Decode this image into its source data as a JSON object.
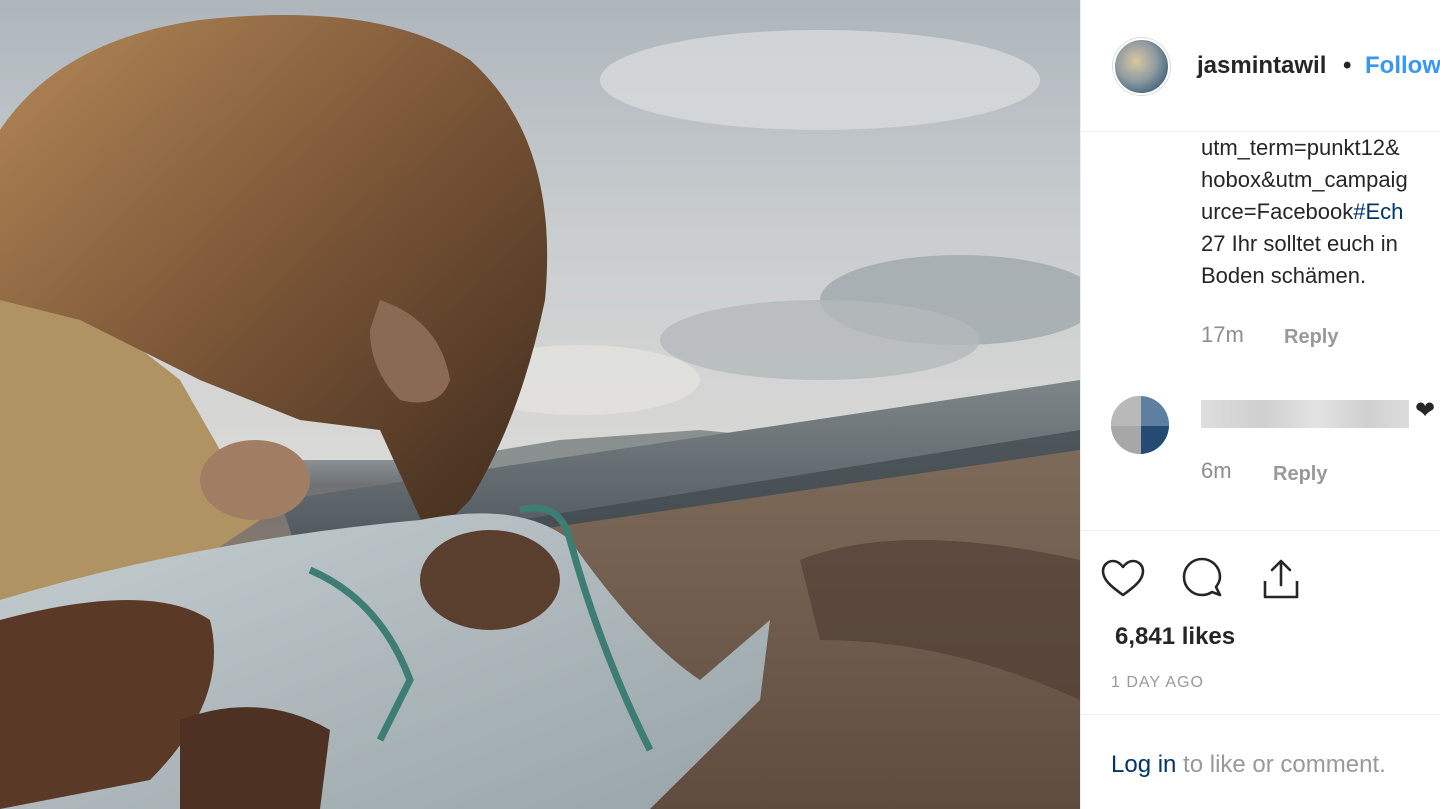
{
  "post": {
    "username": "jasmintawil",
    "separator": "•",
    "follow_label": "Follow",
    "likes": "6,841 likes",
    "date": "1 DAY AGO"
  },
  "comments": [
    {
      "lines": [
        "utm_term=punkt12&",
        "hobox&utm_campaig",
        "urce=Facebook",
        "27 Ihr solltet euch in",
        "Boden schämen."
      ],
      "hashtag": "#Ech",
      "time": "17m",
      "reply_label": "Reply"
    },
    {
      "time": "6m",
      "reply_label": "Reply"
    }
  ],
  "login": {
    "link": "Log in",
    "rest": " to like or comment."
  },
  "icons": {
    "like": "heart-outline-icon",
    "comment": "speech-bubble-icon",
    "share": "share-upload-icon",
    "reacted": "heart-filled-icon"
  },
  "colors": {
    "follow": "#3897f0",
    "link": "#003569",
    "muted": "#999999",
    "text": "#262626"
  }
}
